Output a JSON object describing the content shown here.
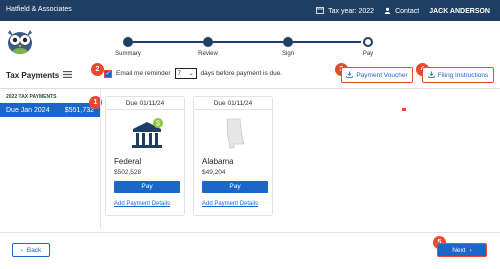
{
  "topbar": {
    "firm": "Hatfield & Associates",
    "tax_year": "Tax year: 2022",
    "contact": "Contact",
    "user": "JACK ANDERSON"
  },
  "stepper": {
    "steps": [
      "Summary",
      "Review",
      "Sign",
      "Pay"
    ]
  },
  "header": {
    "title": "Tax Payments",
    "reminder_prefix": "Email me reminder",
    "reminder_value": "7",
    "reminder_suffix": "days before payment is due.",
    "payment_voucher": "Payment Voucher",
    "filing_instructions": "Filing Instructions"
  },
  "sidebar": {
    "heading": "2022 TAX PAYMENTS",
    "item_label": "Due Jan 2024",
    "item_amount": "$551,732"
  },
  "cards": [
    {
      "due": "Due 01/11/24",
      "name": "Federal",
      "amount": "$502,528",
      "pay": "Pay",
      "link": "Add Payment Details",
      "badge": "$"
    },
    {
      "due": "Due 01/11/24",
      "name": "Alabama",
      "amount": "$49,204",
      "pay": "Pay",
      "link": "Add Payment Details"
    }
  ],
  "footer": {
    "back": "Back",
    "next": "Next"
  },
  "badges": {
    "b1": "1",
    "b2": "2",
    "b3": "3",
    "b4": "4",
    "b5": "5"
  },
  "colors": {
    "navy": "#1f3e63",
    "primary": "#1a66c9",
    "annotation": "#e8492f"
  }
}
